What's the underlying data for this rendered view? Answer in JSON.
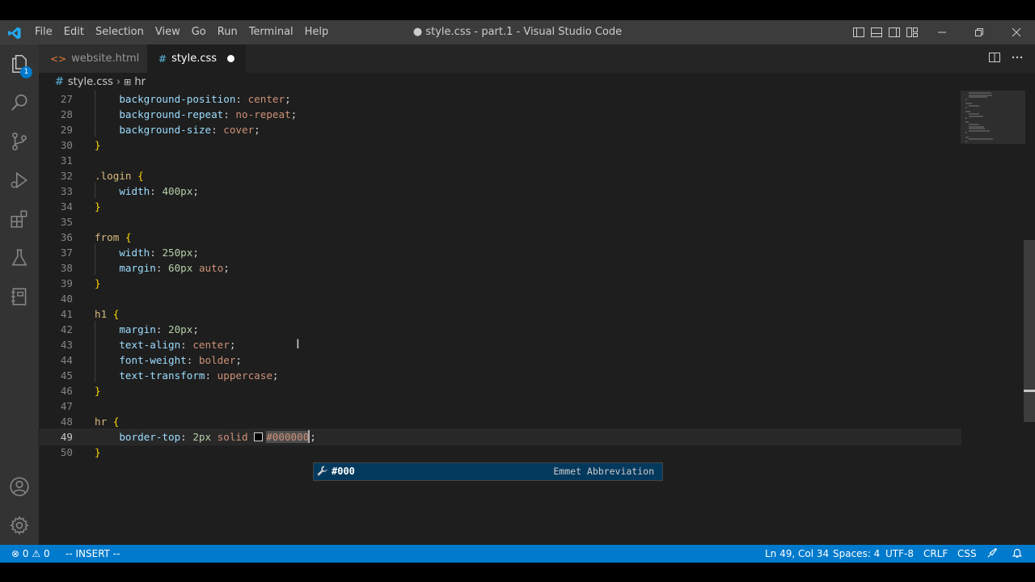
{
  "titlebar": {
    "menu": [
      "File",
      "Edit",
      "Selection",
      "View",
      "Go",
      "Run",
      "Terminal",
      "Help"
    ],
    "window_title": "● style.css - part.1 - Visual Studio Code"
  },
  "activity_bar": {
    "explorer_badge": "1"
  },
  "tabs": [
    {
      "label": "website.html",
      "icon": "html-file-icon",
      "active": false
    },
    {
      "label": "style.css",
      "icon": "css-file-icon",
      "active": true,
      "dirty": true
    }
  ],
  "breadcrumb": {
    "file": "style.css",
    "symbol": "hr"
  },
  "editor": {
    "lines": [
      {
        "n": "27",
        "text": "    background-position: center;"
      },
      {
        "n": "28",
        "text": "    background-repeat: no-repeat;"
      },
      {
        "n": "29",
        "text": "    background-size: cover;"
      },
      {
        "n": "30",
        "text": "}"
      },
      {
        "n": "31",
        "text": ""
      },
      {
        "n": "32",
        "text": ".login {"
      },
      {
        "n": "33",
        "text": "    width: 400px;"
      },
      {
        "n": "34",
        "text": "}"
      },
      {
        "n": "35",
        "text": ""
      },
      {
        "n": "36",
        "text": "from {"
      },
      {
        "n": "37",
        "text": "    width: 250px;"
      },
      {
        "n": "38",
        "text": "    margin: 60px auto;"
      },
      {
        "n": "39",
        "text": "}"
      },
      {
        "n": "40",
        "text": ""
      },
      {
        "n": "41",
        "text": "h1 {"
      },
      {
        "n": "42",
        "text": "    margin: 20px;"
      },
      {
        "n": "43",
        "text": "    text-align: center;"
      },
      {
        "n": "44",
        "text": "    font-weight: bolder;"
      },
      {
        "n": "45",
        "text": "    text-transform: uppercase;"
      },
      {
        "n": "46",
        "text": "}"
      },
      {
        "n": "47",
        "text": ""
      },
      {
        "n": "48",
        "text": "hr {"
      },
      {
        "n": "49",
        "text": "    border-top: 2px solid #000000;",
        "current": true
      },
      {
        "n": "50",
        "text": "}"
      }
    ]
  },
  "suggestion": {
    "label": "#000",
    "detail": "Emmet Abbreviation"
  },
  "statusbar": {
    "errors": "0",
    "warnings": "0",
    "mode": "-- INSERT --",
    "position": "Ln 49, Col 34",
    "spaces": "Spaces: 4",
    "encoding": "UTF-8",
    "eol": "CRLF",
    "language": "CSS"
  },
  "colors": {
    "accent": "#007acc",
    "editor_bg": "#1e1e1e",
    "selector": "#d7ba7d",
    "property": "#9cdcfe",
    "value": "#ce9178",
    "number": "#b5cea8",
    "bracket": "#ffd700"
  }
}
